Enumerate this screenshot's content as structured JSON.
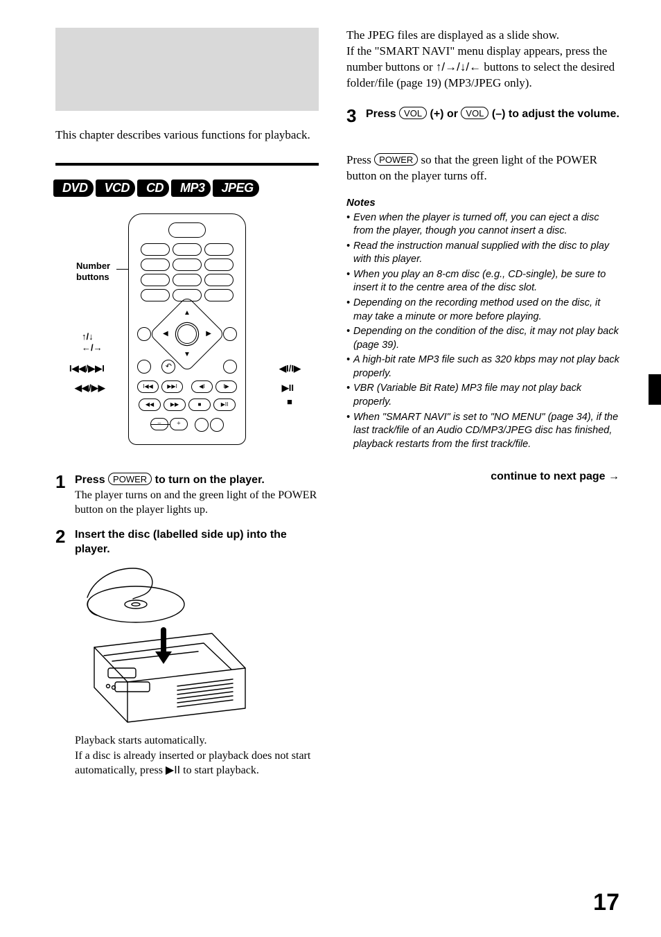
{
  "intro": "This chapter describes various functions for playback.",
  "badges": [
    "DVD",
    "VCD",
    "CD",
    "MP3",
    "JPEG"
  ],
  "remote_callouts": {
    "number_buttons": "Number\nbuttons",
    "up_down": "↑/↓",
    "left_right": "←/→",
    "prev_next": "I◀◀/▶▶I",
    "rew_ff": "◀◀/▶▶",
    "step_prev_next": "◀I/I▶",
    "play_pause": "▶II",
    "stop": "■"
  },
  "step1": {
    "num": "1",
    "bold_a": "Press ",
    "key": "POWER",
    "bold_b": " to turn on the player.",
    "desc": "The player turns on and the green light of the POWER button on the player lights up."
  },
  "step2": {
    "num": "2",
    "bold": "Insert the disc  (labelled side up) into the player.",
    "desc1": "Playback starts automatically.",
    "desc2_a": "If a disc is already inserted or playback does not start automatically, press ",
    "desc2_glyph": "▶II",
    "desc2_b": " to start playback."
  },
  "rcol": {
    "p1": "The JPEG files are displayed as a slide show.",
    "p2_a": "If the \"SMART NAVI\" menu display appears, press the number buttons or ",
    "p2_glyphs": "↑/→/↓/←",
    "p2_b": " buttons to select the desired folder/file (page 19) (MP3/JPEG only).",
    "step3_num": "3",
    "step3_a": "Press ",
    "step3_key1": "VOL",
    "step3_mid": " (+) or ",
    "step3_key2": "VOL",
    "step3_b": " (–) to adjust the volume.",
    "off_a": "Press ",
    "off_key": "POWER",
    "off_b": " so that the green light of the POWER button on the player turns off.",
    "notes_head": "Notes",
    "notes": [
      "Even when the player is turned off, you can eject a disc from the player, though you cannot insert a disc.",
      "Read the instruction manual supplied with the disc to play with this player.",
      "When you play an 8-cm disc (e.g., CD-single), be sure to insert it to the centre area of the disc slot.",
      "Depending on the recording method used on the disc, it may take a minute or more before playing.",
      "Depending on the condition of the disc, it may not play back (page 39).",
      "A high-bit rate MP3 file such as 320 kbps may not play back properly.",
      "VBR (Variable Bit Rate) MP3 file may not play back properly.",
      "When \"SMART NAVI\" is set to \"NO MENU\" (page 34), if the last track/file of an Audio CD/MP3/JPEG disc has finished, playback restarts from the first track/file."
    ],
    "continue": "continue to next page →"
  },
  "page_num": "17"
}
